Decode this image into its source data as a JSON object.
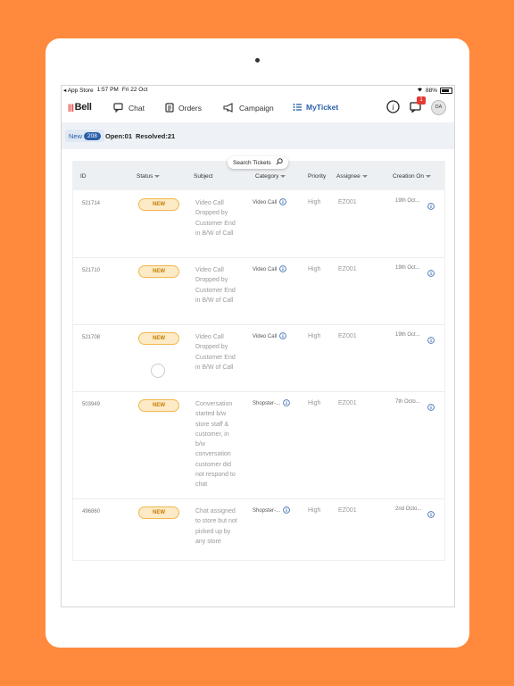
{
  "status_bar": {
    "app_store": "◂ App Store",
    "time": "1:57 PM",
    "date": "Fri 22 Oct",
    "battery": "88%"
  },
  "nav": {
    "logo": "Bell",
    "chat": "Chat",
    "orders": "Orders",
    "campaign": "Campaign",
    "myticket": "MyTicket",
    "notification_count": "1",
    "avatar_initials": "DA"
  },
  "filters": {
    "new_label": "New",
    "new_count": "208",
    "open": "Open:01",
    "resolved": "Resolved:21"
  },
  "search": {
    "label": "Search Tickets"
  },
  "table": {
    "headers": {
      "id": "ID",
      "status": "Status",
      "subject": "Subject",
      "category": "Category",
      "priority": "Priority",
      "assignee": "Assignee",
      "creation_on": "Creation On"
    },
    "rows": [
      {
        "id": "521714",
        "status": "NEW",
        "subject": "Video Call Dropped by Customer End in B/W of Call",
        "category": "Video Call",
        "priority": "High",
        "assignee": "EZ001",
        "created": "19th Oct..."
      },
      {
        "id": "521710",
        "status": "NEW",
        "subject": "Video Call Dropped by Customer End in B/W of Call",
        "category": "Video Call",
        "priority": "High",
        "assignee": "EZ001",
        "created": "19th Oct..."
      },
      {
        "id": "521708",
        "status": "NEW",
        "subject": "Video Call Dropped by Customer End in B/W of Call",
        "category": "Video Call",
        "priority": "High",
        "assignee": "EZ001",
        "created": "19th Oct..."
      },
      {
        "id": "503949",
        "status": "NEW",
        "subject": "Conversation started b/w store staff & customer, in b/w conversation customer did not respond to chat",
        "category": "Shopster-...",
        "priority": "High",
        "assignee": "EZ001",
        "created": "7th Octo..."
      },
      {
        "id": "496860",
        "status": "NEW",
        "subject": "Chat assigned to store but not picked up by any store",
        "category": "Shopster-...",
        "priority": "High",
        "assignee": "EZ001",
        "created": "2nd Octo..."
      }
    ]
  }
}
